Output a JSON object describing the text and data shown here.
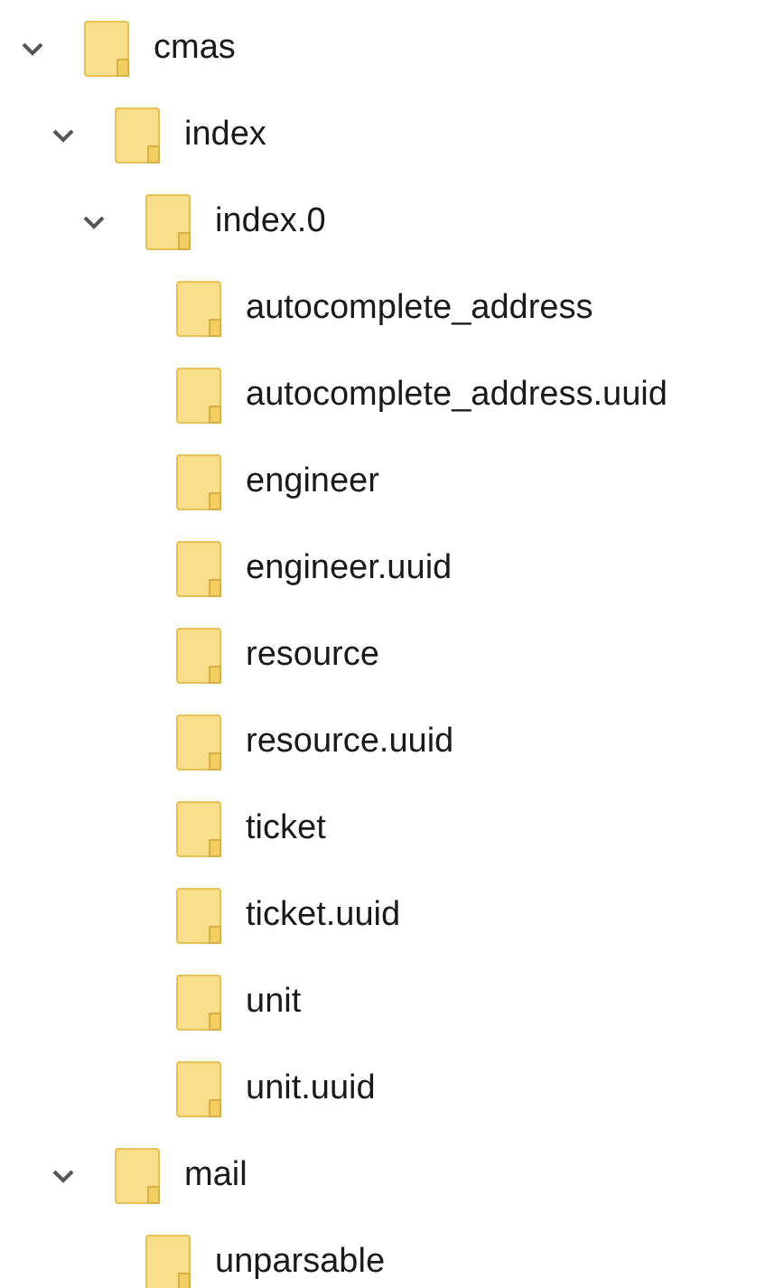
{
  "tree": [
    {
      "label": "cmas",
      "expanded": true,
      "children": [
        {
          "label": "index",
          "expanded": true,
          "children": [
            {
              "label": "index.0",
              "expanded": true,
              "children": [
                {
                  "label": "autocomplete_address"
                },
                {
                  "label": "autocomplete_address.uuid"
                },
                {
                  "label": "engineer"
                },
                {
                  "label": "engineer.uuid"
                },
                {
                  "label": "resource"
                },
                {
                  "label": "resource.uuid"
                },
                {
                  "label": "ticket"
                },
                {
                  "label": "ticket.uuid"
                },
                {
                  "label": "unit"
                },
                {
                  "label": "unit.uuid"
                }
              ]
            }
          ]
        },
        {
          "label": "mail",
          "expanded": true,
          "children": [
            {
              "label": "unparsable"
            }
          ]
        }
      ]
    }
  ]
}
